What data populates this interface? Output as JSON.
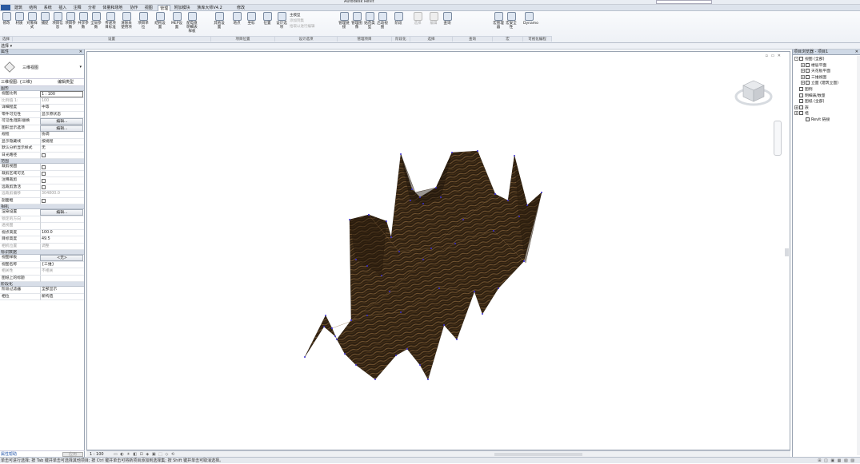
{
  "tabs": [
    "建筑",
    "结构",
    "系统",
    "插入",
    "注释",
    "分析",
    "体量和场地",
    "协作",
    "视图",
    "管理",
    "附加模块",
    "族库大师V4.2",
    "修改"
  ],
  "active_tab_index": 9,
  "ribbon": {
    "buttons": [
      {
        "label": "修改",
        "icon": "cursor-icon"
      },
      {
        "label": "材质",
        "icon": "material-icon"
      },
      {
        "label": "对象样式",
        "icon": "object-styles-icon"
      },
      {
        "label": "捕捉",
        "icon": "snap-icon"
      },
      {
        "label": "项目信息",
        "icon": "project-info-icon"
      },
      {
        "label": "项目参数",
        "icon": "project-params-icon"
      },
      {
        "label": "共享参数",
        "icon": "shared-params-icon"
      },
      {
        "label": "全局参数",
        "icon": "global-params-icon"
      },
      {
        "label": "传递项目标准",
        "icon": "transfer-standards-icon"
      },
      {
        "label": "清除未使用项",
        "icon": "purge-icon"
      },
      {
        "label": "项目单位",
        "icon": "units-icon"
      },
      {
        "label": "结构设置",
        "icon": "structural-settings-icon"
      },
      {
        "label": "MEP设置",
        "icon": "mep-settings-icon"
      },
      {
        "label": "配电盘明细表样板",
        "icon": "panel-schedule-icon"
      },
      {
        "label": "其他设置",
        "icon": "wrench-icon"
      },
      {
        "label": "地点",
        "icon": "globe-icon"
      },
      {
        "label": "坐标",
        "icon": "coordinates-icon"
      },
      {
        "label": "位置",
        "icon": "position-icon"
      },
      {
        "label": "设计选项",
        "icon": "design-options-icon"
      },
      {
        "label": "管理链接",
        "icon": "manage-links-icon"
      },
      {
        "label": "管理图像",
        "icon": "manage-images-icon"
      },
      {
        "label": "贴花类型",
        "icon": "decal-icon"
      },
      {
        "label": "启动视图",
        "icon": "startup-view-icon"
      },
      {
        "label": "阶段",
        "icon": "phases-icon"
      },
      {
        "label": "选择",
        "icon": "selection-icon"
      },
      {
        "label": "编辑",
        "icon": "edit-icon"
      },
      {
        "label": "查询",
        "icon": "inquiry-icon"
      },
      {
        "label": "宏管理器",
        "icon": "macro-manager-icon"
      },
      {
        "label": "宏安全性",
        "icon": "macro-security-icon"
      },
      {
        "label": "Dynamo",
        "icon": "dynamo-icon"
      }
    ],
    "panels": [
      "选择",
      "设置",
      "项目位置",
      "设计选项",
      "管理项目",
      "阶段化",
      "选择",
      "查询",
      "宏",
      "可视化编程"
    ],
    "design_options_text": [
      "主模型",
      "添加到集",
      "拾取以进行编辑"
    ]
  },
  "subbar": {
    "select_label": "选择 ▾"
  },
  "properties": {
    "title": "属性",
    "type_name": "三维视图",
    "filter": "三维视图: {三维}",
    "edit_type": "编辑类型",
    "groups": [
      {
        "name": "图形",
        "rows": [
          {
            "k": "视图比例",
            "v": "1 : 100",
            "style": "box"
          },
          {
            "k": "比例值 1:",
            "v": "100",
            "style": "dim"
          },
          {
            "k": "详细程度",
            "v": "中等"
          },
          {
            "k": "零件可见性",
            "v": "显示原状态"
          },
          {
            "k": "可见性/图形替换",
            "v": "编辑...",
            "style": "btn"
          },
          {
            "k": "图形显示选项",
            "v": "编辑...",
            "style": "btn"
          },
          {
            "k": "规程",
            "v": "协调"
          },
          {
            "k": "显示隐藏线",
            "v": "按规程"
          },
          {
            "k": "默认分析显示样式",
            "v": "无"
          },
          {
            "k": "日光路径",
            "v": "",
            "style": "chk"
          }
        ]
      },
      {
        "name": "范围",
        "rows": [
          {
            "k": "裁剪视图",
            "v": "",
            "style": "chk"
          },
          {
            "k": "裁剪区域可见",
            "v": "",
            "style": "chk"
          },
          {
            "k": "注释裁剪",
            "v": "",
            "style": "chk"
          },
          {
            "k": "远裁剪激活",
            "v": "",
            "style": "chk"
          },
          {
            "k": "远裁剪偏移",
            "v": "304800.0",
            "style": "dim"
          },
          {
            "k": "剖面框",
            "v": "",
            "style": "chk"
          }
        ]
      },
      {
        "name": "相机",
        "rows": [
          {
            "k": "渲染设置",
            "v": "编辑...",
            "style": "btn"
          },
          {
            "k": "锁定的方向",
            "v": "",
            "style": "dim"
          },
          {
            "k": "透视图",
            "v": "",
            "style": "dim"
          },
          {
            "k": "视点高度",
            "v": "100.0"
          },
          {
            "k": "目标高度",
            "v": "49.5"
          },
          {
            "k": "相机位置",
            "v": "调整",
            "style": "dim"
          }
        ]
      },
      {
        "name": "标识数据",
        "rows": [
          {
            "k": "视图样板",
            "v": "<无>",
            "style": "btn"
          },
          {
            "k": "视图名称",
            "v": "{三维}"
          },
          {
            "k": "相关性",
            "v": "不相关",
            "style": "dim"
          },
          {
            "k": "图纸上的标题",
            "v": ""
          }
        ]
      },
      {
        "name": "阶段化",
        "rows": [
          {
            "k": "阶段过滤器",
            "v": "全部显示"
          },
          {
            "k": "相位",
            "v": "新构造"
          }
        ]
      }
    ],
    "help_link": "属性帮助",
    "apply": "应用"
  },
  "view": {
    "controls": "▫ ▭ ✕",
    "scale": "1 : 100",
    "surface_color": "#3a2816",
    "vertex_color": "#3a2fd0"
  },
  "browser": {
    "title": "项目浏览器 - 项目1",
    "nodes": [
      {
        "label": "视图 (全部)",
        "level": 0,
        "exp": "-"
      },
      {
        "label": "楼层平面",
        "level": 1,
        "exp": "+"
      },
      {
        "label": "天花板平面",
        "level": 1,
        "exp": "+"
      },
      {
        "label": "三维视图",
        "level": 1,
        "exp": "+"
      },
      {
        "label": "立面 (建筑立面)",
        "level": 1,
        "exp": "+"
      },
      {
        "label": "图例",
        "level": 0,
        "exp": ""
      },
      {
        "label": "明细表/数量",
        "level": 0,
        "exp": ""
      },
      {
        "label": "图纸 (全部)",
        "level": 0,
        "exp": ""
      },
      {
        "label": "族",
        "level": 0,
        "exp": "+"
      },
      {
        "label": "组",
        "level": 0,
        "exp": "+"
      },
      {
        "label": "Revit 链接",
        "level": 1,
        "exp": ""
      }
    ]
  },
  "status": {
    "message": "单击可进行选择; 按 Tab 键并单击可选择其他项目; 按 Ctrl 键并单击可将新项目添加到选择集; 按 Shift 键并单击可取消选择。",
    "right_icons": "⊞ ◫ ▣ ▦ ▧ ▨"
  }
}
